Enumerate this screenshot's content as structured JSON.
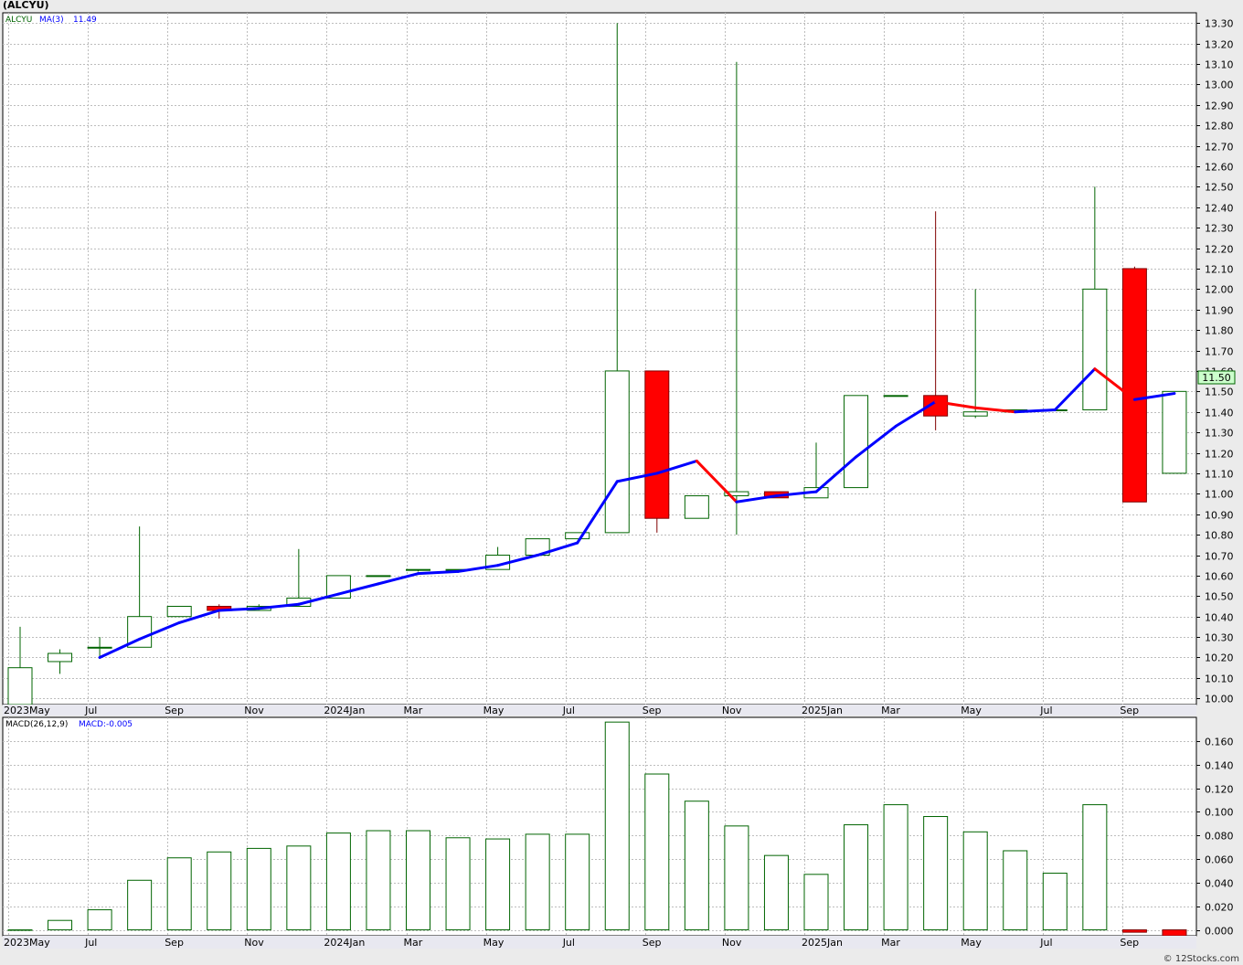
{
  "title": "(ALCYU)",
  "credit": "© 12Stocks.com",
  "colors": {
    "up": "#006400",
    "down": "#ff0000",
    "ma_up": "#0000ff",
    "ma_down": "#ff0000",
    "grid": "#bdbdbd",
    "bg": "#ffffff",
    "page": "#ebebeb",
    "last_badge": "#ccffcc"
  },
  "chart_data": [
    {
      "type": "candlestick",
      "panel": "price",
      "legend": {
        "symbol": "ALCYU",
        "ma_label": "MA(3)",
        "ma_value": "11.49"
      },
      "last_price_label": "11.50",
      "ylim": [
        9.97,
        13.35
      ],
      "yticks": [
        "10.00",
        "10.10",
        "10.20",
        "10.30",
        "10.40",
        "10.50",
        "10.60",
        "10.70",
        "10.80",
        "10.90",
        "11.00",
        "11.10",
        "11.20",
        "11.30",
        "11.40",
        "11.50",
        "11.60",
        "11.70",
        "11.80",
        "11.90",
        "12.00",
        "12.10",
        "12.20",
        "12.30",
        "12.40",
        "12.50",
        "12.60",
        "12.70",
        "12.80",
        "12.90",
        "13.00",
        "13.10",
        "13.20",
        "13.30"
      ],
      "xlabels": [
        "2023May",
        "Jul",
        "Sep",
        "Nov",
        "2024Jan",
        "Mar",
        "May",
        "Jul",
        "Sep",
        "Nov",
        "2025Jan",
        "Mar",
        "May",
        "Jul",
        "Sep"
      ],
      "candles": [
        {
          "open": 9.97,
          "high": 10.35,
          "low": 9.97,
          "close": 10.15
        },
        {
          "open": 10.18,
          "high": 10.24,
          "low": 10.12,
          "close": 10.22
        },
        {
          "open": 10.25,
          "high": 10.3,
          "low": 10.2,
          "close": 10.25
        },
        {
          "open": 10.25,
          "high": 10.84,
          "low": 10.25,
          "close": 10.4
        },
        {
          "open": 10.4,
          "high": 10.45,
          "low": 10.4,
          "close": 10.45
        },
        {
          "open": 10.45,
          "high": 10.46,
          "low": 10.39,
          "close": 10.43
        },
        {
          "open": 10.43,
          "high": 10.46,
          "low": 10.43,
          "close": 10.45
        },
        {
          "open": 10.45,
          "high": 10.73,
          "low": 10.45,
          "close": 10.49
        },
        {
          "open": 10.49,
          "high": 10.6,
          "low": 10.49,
          "close": 10.6
        },
        {
          "open": 10.6,
          "high": 10.6,
          "low": 10.6,
          "close": 10.6
        },
        {
          "open": 10.63,
          "high": 10.63,
          "low": 10.62,
          "close": 10.63
        },
        {
          "open": 10.63,
          "high": 10.63,
          "low": 10.63,
          "close": 10.63
        },
        {
          "open": 10.63,
          "high": 10.74,
          "low": 10.63,
          "close": 10.7
        },
        {
          "open": 10.7,
          "high": 10.78,
          "low": 10.7,
          "close": 10.78
        },
        {
          "open": 10.78,
          "high": 10.81,
          "low": 10.78,
          "close": 10.81
        },
        {
          "open": 10.81,
          "high": 13.3,
          "low": 10.81,
          "close": 11.6
        },
        {
          "open": 11.6,
          "high": 11.6,
          "low": 10.81,
          "close": 10.88
        },
        {
          "open": 10.88,
          "high": 10.99,
          "low": 10.88,
          "close": 10.99
        },
        {
          "open": 10.99,
          "high": 13.11,
          "low": 10.8,
          "close": 11.01
        },
        {
          "open": 11.01,
          "high": 11.01,
          "low": 10.98,
          "close": 10.98
        },
        {
          "open": 10.98,
          "high": 11.25,
          "low": 10.98,
          "close": 11.03
        },
        {
          "open": 11.03,
          "high": 11.48,
          "low": 11.03,
          "close": 11.48
        },
        {
          "open": 11.48,
          "high": 11.48,
          "low": 11.48,
          "close": 11.48
        },
        {
          "open": 11.48,
          "high": 12.38,
          "low": 11.31,
          "close": 11.38
        },
        {
          "open": 11.38,
          "high": 12.0,
          "low": 11.37,
          "close": 11.4
        },
        {
          "open": 11.4,
          "high": 11.4,
          "low": 11.4,
          "close": 11.41
        },
        {
          "open": 11.41,
          "high": 11.41,
          "low": 11.41,
          "close": 11.41
        },
        {
          "open": 11.41,
          "high": 12.5,
          "low": 11.41,
          "close": 12.0
        },
        {
          "open": 12.1,
          "high": 12.11,
          "low": 10.96,
          "close": 10.96
        },
        {
          "open": 11.1,
          "high": 11.5,
          "low": 11.1,
          "close": 11.5
        }
      ],
      "ma": [
        null,
        null,
        10.2,
        10.29,
        10.37,
        10.43,
        10.44,
        10.46,
        10.51,
        10.56,
        10.61,
        10.62,
        10.65,
        10.7,
        10.76,
        11.06,
        11.1,
        11.16,
        10.96,
        10.99,
        11.01,
        11.18,
        11.33,
        11.45,
        11.42,
        11.4,
        11.41,
        11.61,
        11.46,
        11.49
      ]
    },
    {
      "type": "bar",
      "panel": "macd",
      "legend": {
        "label": "MACD(26,12,9)",
        "value_label": "MACD:-0.005"
      },
      "ylim": [
        -0.005,
        0.18
      ],
      "yticks": [
        "0.000",
        "0.020",
        "0.040",
        "0.060",
        "0.080",
        "0.100",
        "0.120",
        "0.140",
        "0.160"
      ],
      "xlabels": [
        "2023May",
        "Jul",
        "Sep",
        "Nov",
        "2024Jan",
        "Mar",
        "May",
        "Jul",
        "Sep",
        "Nov",
        "2025Jan",
        "Mar",
        "May",
        "Jul",
        "Sep"
      ],
      "values": [
        0,
        0.008,
        0.017,
        0.042,
        0.061,
        0.066,
        0.069,
        0.071,
        0.082,
        0.084,
        0.084,
        0.078,
        0.077,
        0.081,
        0.081,
        0.176,
        0.132,
        0.109,
        0.088,
        0.063,
        0.047,
        0.089,
        0.106,
        0.096,
        0.083,
        0.067,
        0.048,
        0.106,
        -0.002,
        -0.005
      ]
    }
  ]
}
